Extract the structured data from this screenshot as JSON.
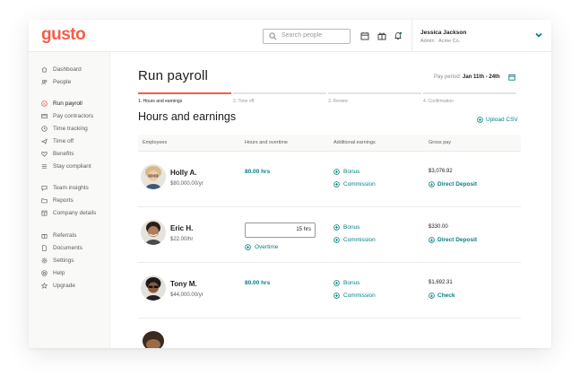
{
  "app": {
    "logo": "gusto",
    "search_placeholder": "Search people",
    "icons": [
      "calendar-icon",
      "gift-icon",
      "bell-icon"
    ],
    "user": {
      "name": "Jessica Jackson",
      "role": "Admin · Acme Co."
    }
  },
  "sidebar": {
    "group1": [
      {
        "label": "Dashboard",
        "icon": "home-icon"
      },
      {
        "label": "People",
        "icon": "people-icon"
      }
    ],
    "group2": [
      {
        "label": "Run payroll",
        "icon": "dollar-icon",
        "active": true
      },
      {
        "label": "Pay contractors",
        "icon": "card-icon"
      },
      {
        "label": "Time tracking",
        "icon": "clock-icon"
      },
      {
        "label": "Time off",
        "icon": "plane-icon"
      },
      {
        "label": "Benefits",
        "icon": "heart-icon"
      },
      {
        "label": "Stay compliant",
        "icon": "list-icon"
      }
    ],
    "group3": [
      {
        "label": "Team insights",
        "icon": "chat-icon"
      },
      {
        "label": "Reports",
        "icon": "folder-icon"
      },
      {
        "label": "Company details",
        "icon": "building-icon"
      }
    ],
    "group4": [
      {
        "label": "Referrals",
        "icon": "gift-icon"
      },
      {
        "label": "Documents",
        "icon": "document-icon"
      },
      {
        "label": "Settings",
        "icon": "gear-icon"
      },
      {
        "label": "Help",
        "icon": "help-icon"
      },
      {
        "label": "Upgrade",
        "icon": "star-icon"
      }
    ]
  },
  "page": {
    "title": "Run payroll",
    "pay_period_label": "Pay period:",
    "pay_period_value": "Jan 11th - 24th",
    "steps": [
      {
        "label": "1. Hours and earnings",
        "current": true
      },
      {
        "label": "2. Time off"
      },
      {
        "label": "3. Review"
      },
      {
        "label": "4. Confirmation"
      }
    ],
    "progress_fraction": 0.25,
    "section_title": "Hours and earnings",
    "upload_label": "Upload CSV"
  },
  "table": {
    "columns": [
      "Employees",
      "Hours and overtime",
      "Additional earnings",
      "Gross pay"
    ],
    "rows": [
      {
        "name": "Holly A.",
        "pay": "$80,000.00/yr",
        "hours": "80.00 hrs",
        "earnings": [
          "Bonus",
          "Commission"
        ],
        "gross": "$3,076.92",
        "method": "Direct Deposit"
      },
      {
        "name": "Eric H.",
        "pay": "$22.00/hr",
        "hours_input": "15 hrs",
        "overtime_label": "Overtime",
        "earnings": [
          "Bonus",
          "Commission"
        ],
        "gross": "$330.00",
        "method": "Direct Deposit"
      },
      {
        "name": "Tony M.",
        "pay": "$44,000.00/yr",
        "hours": "80.00 hrs",
        "earnings": [
          "Bonus",
          "Commission"
        ],
        "gross": "$1,692.31",
        "method": "Check"
      }
    ]
  },
  "colors": {
    "brand": "#f45d48",
    "accent": "#0a8080"
  }
}
